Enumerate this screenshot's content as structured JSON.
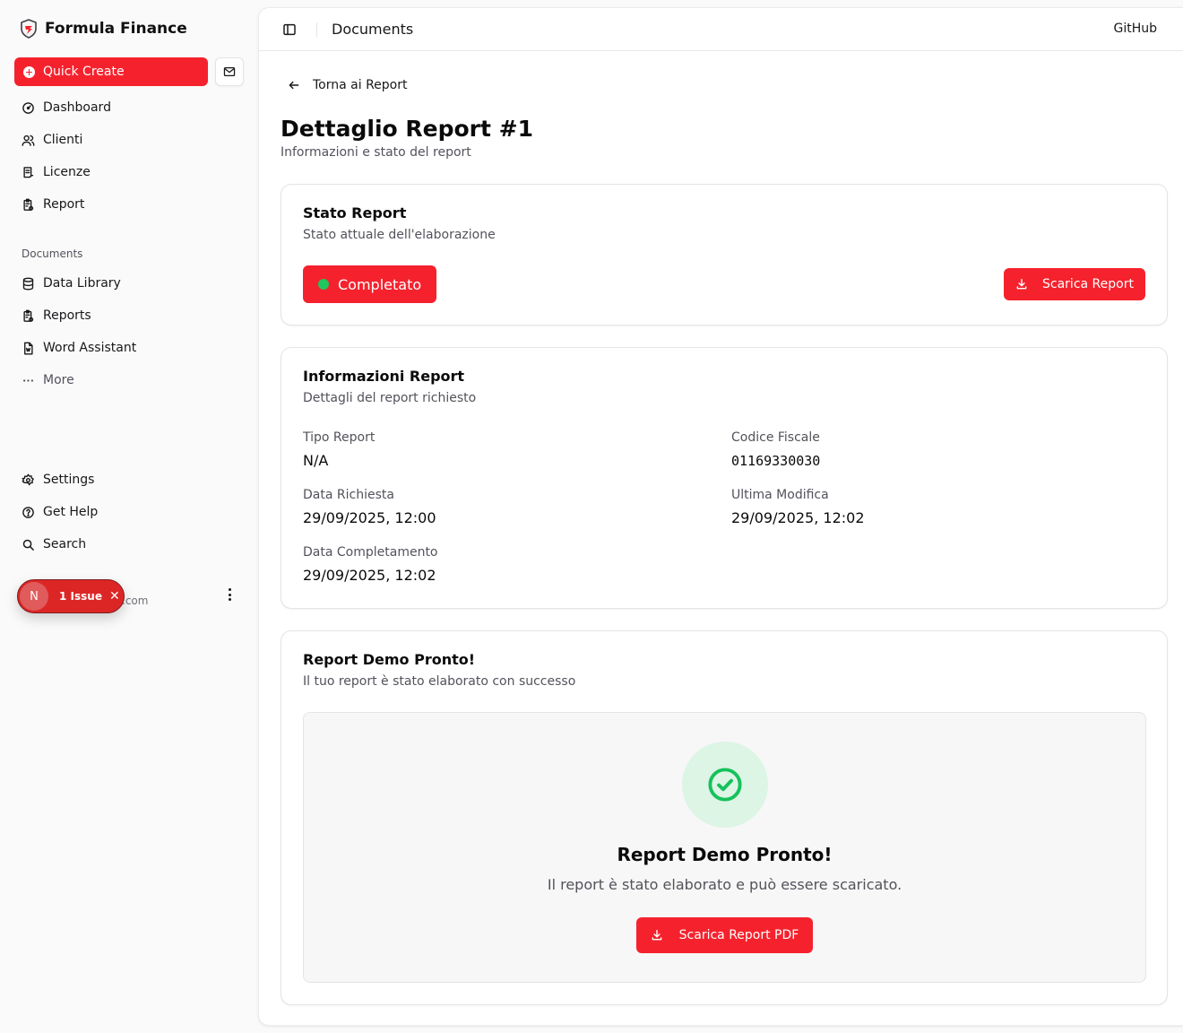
{
  "app": {
    "name": "Formula Finance"
  },
  "sidebar": {
    "quick_create": "Quick Create",
    "main_items": [
      {
        "label": "Dashboard",
        "icon": "dashboard-icon"
      },
      {
        "label": "Clienti",
        "icon": "users-icon"
      },
      {
        "label": "Licenze",
        "icon": "license-icon"
      },
      {
        "label": "Report",
        "icon": "report-icon"
      }
    ],
    "documents_label": "Documents",
    "doc_items": [
      {
        "label": "Data Library",
        "icon": "database-icon"
      },
      {
        "label": "Reports",
        "icon": "report-icon"
      },
      {
        "label": "Word Assistant",
        "icon": "word-file-icon"
      },
      {
        "label": "More",
        "icon": "ellipsis-icon"
      }
    ],
    "bottom_items": [
      {
        "label": "Settings",
        "icon": "gear-icon"
      },
      {
        "label": "Get Help",
        "icon": "help-icon"
      },
      {
        "label": "Search",
        "icon": "search-icon"
      }
    ],
    "user_email_fragment": ".com"
  },
  "issue_badge": {
    "initial": "N",
    "label": "1 Issue"
  },
  "topbar": {
    "title": "Documents",
    "github": "GitHub"
  },
  "page": {
    "back": "Torna ai Report",
    "title": "Dettaglio Report #1",
    "subtitle": "Informazioni e stato del report"
  },
  "status_card": {
    "title": "Stato Report",
    "description": "Stato attuale dell'elaborazione",
    "status": "Completato",
    "download": "Scarica Report"
  },
  "info_card": {
    "title": "Informazioni Report",
    "description": "Dettagli del report richiesto",
    "fields": {
      "tipo_report": {
        "label": "Tipo Report",
        "value": "N/A"
      },
      "codice_fiscale": {
        "label": "Codice Fiscale",
        "value": "01169330030"
      },
      "data_richiesta": {
        "label": "Data Richiesta",
        "value": "29/09/2025, 12:00"
      },
      "ultima_modifica": {
        "label": "Ultima Modifica",
        "value": "29/09/2025, 12:02"
      },
      "data_completamento": {
        "label": "Data Completamento",
        "value": "29/09/2025, 12:02"
      }
    }
  },
  "demo_card": {
    "title": "Report Demo Pronto!",
    "description": "Il tuo report è stato elaborato con successo",
    "box_title": "Report Demo Pronto!",
    "box_text": "Il report è stato elaborato e può essere scaricato.",
    "download_pdf": "Scarica Report PDF"
  },
  "colors": {
    "accent": "#f5222d",
    "success": "#22c55e",
    "success_bg": "#dcf5e5"
  }
}
